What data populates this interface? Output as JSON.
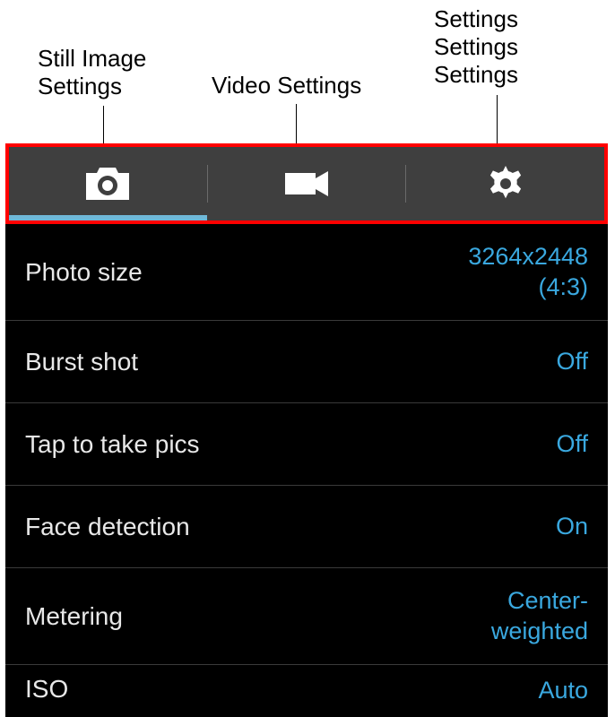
{
  "annotations": {
    "still": "Still Image\nSettings",
    "video": "Video Settings",
    "settings": "Settings\nSettings\nSettings"
  },
  "tabs": {
    "camera": "camera-icon",
    "video": "video-icon",
    "gear": "gear-icon"
  },
  "settings": {
    "photo_size": {
      "label": "Photo size",
      "value": "3264x2448\n(4:3)"
    },
    "burst_shot": {
      "label": "Burst shot",
      "value": "Off"
    },
    "tap_pics": {
      "label": "Tap to take pics",
      "value": "Off"
    },
    "face_detection": {
      "label": "Face detection",
      "value": "On"
    },
    "metering": {
      "label": "Metering",
      "value": "Center-\nweighted"
    },
    "iso": {
      "label": "ISO",
      "value": "Auto"
    }
  }
}
